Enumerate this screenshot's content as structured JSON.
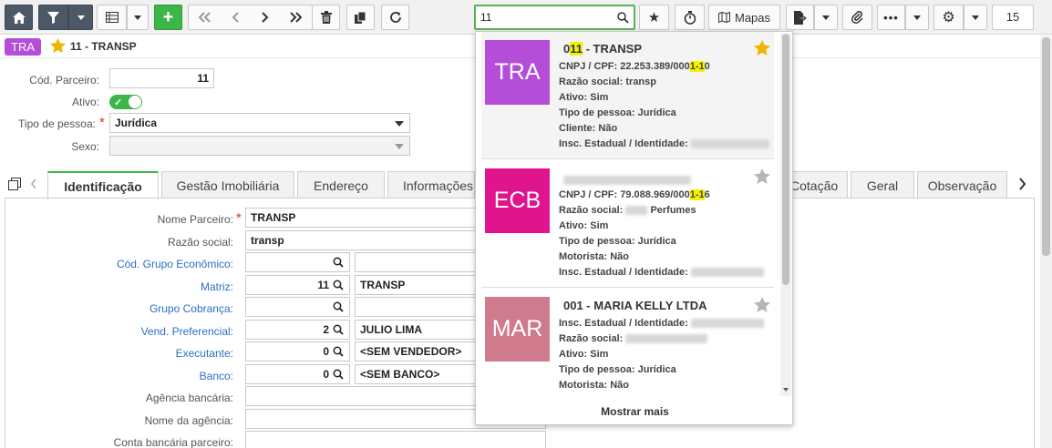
{
  "toolbar": {
    "mapas_label": "Mapas",
    "search_value": "11",
    "page_number": "15"
  },
  "record": {
    "badge": "TRA",
    "title": "11 - TRANSP"
  },
  "form": {
    "cod_parceiro_label": "Cód. Parceiro:",
    "cod_parceiro_value": "11",
    "ativo_label": "Ativo:",
    "tipo_pessoa_label": "Tipo de pessoa:",
    "tipo_pessoa_value": "Jurídica",
    "sexo_label": "Sexo:",
    "sexo_value": ""
  },
  "tabs": [
    {
      "label": "Identificação"
    },
    {
      "label": "Gestão Imobiliária"
    },
    {
      "label": "Endereço"
    },
    {
      "label": "Informações"
    },
    {
      "label": "Cotação"
    },
    {
      "label": "Geral"
    },
    {
      "label": "Observação"
    }
  ],
  "ident": {
    "nome_parceiro_label": "Nome Parceiro:",
    "nome_parceiro_value": "TRANSP",
    "razao_social_label": "Razão social:",
    "razao_social_value": "transp",
    "grupo_economico_label": "Cód. Grupo Econômico:",
    "matriz_label": "Matriz:",
    "matriz_code": "11",
    "matriz_name": "TRANSP",
    "grupo_cobranca_label": "Grupo Cobrança:",
    "vend_label": "Vend. Preferencial:",
    "vend_code": "2",
    "vend_name": "JULIO LIMA",
    "executante_label": "Executante:",
    "executante_code": "0",
    "executante_name": "<SEM VENDEDOR>",
    "banco_label": "Banco:",
    "banco_code": "0",
    "banco_name": "<SEM BANCO>",
    "agencia_label": "Agência bancária:",
    "nome_agencia_label": "Nome da agência:",
    "conta_label": "Conta bancária parceiro:"
  },
  "popup": {
    "mostrar_mais": "Mostrar mais",
    "cards": [
      {
        "avatar": "TRA",
        "avatar_color": "#b44ed8",
        "title_pre": "0",
        "title_hl": "11",
        "title_post": " - TRANSP",
        "starred": true,
        "lines": [
          {
            "label": "CNPJ / CPF:",
            "pre": "22.253.389/000",
            "hl": "1-1",
            "post": "0"
          },
          {
            "label": "Razão social:",
            "pre": "transp"
          },
          {
            "label": "Ativo:",
            "pre": "Sim"
          },
          {
            "label": "Tipo de pessoa:",
            "pre": "Jurídica"
          },
          {
            "label": "Cliente:",
            "pre": "Não"
          },
          {
            "label": "Insc. Estadual / Identidade:",
            "pre": ""
          }
        ]
      },
      {
        "avatar": "ECB",
        "avatar_color": "#e0158e",
        "starred": false,
        "lines": [
          {
            "label": "CNPJ / CPF:",
            "pre": "79.088.969/000",
            "hl": "1-1",
            "post": "6"
          },
          {
            "label": "Razão social:",
            "pre": "Perfumes"
          },
          {
            "label": "Ativo:",
            "pre": "Sim"
          },
          {
            "label": "Tipo de pessoa:",
            "pre": "Jurídica"
          },
          {
            "label": "Motorista:",
            "pre": "Não"
          },
          {
            "label": "Insc. Estadual / Identidade:",
            "pre": ""
          }
        ]
      },
      {
        "avatar": "MAR",
        "avatar_color": "#cf7a8d",
        "title_pre": "001 - MARIA KELLY LTDA",
        "starred": false,
        "lines": [
          {
            "label": "Insc. Estadual / Identidade:",
            "pre": ""
          },
          {
            "label": "Razão social:",
            "pre": ""
          },
          {
            "label": "Ativo:",
            "pre": "Sim"
          },
          {
            "label": "Tipo de pessoa:",
            "pre": "Jurídica"
          },
          {
            "label": "Motorista:",
            "pre": "Não"
          }
        ]
      }
    ]
  },
  "colors": {
    "accent_green": "#3cb54a",
    "star_gold": "#f0b400",
    "link_blue": "#2b6fc2",
    "toolbar_dark": "#4c5866"
  }
}
